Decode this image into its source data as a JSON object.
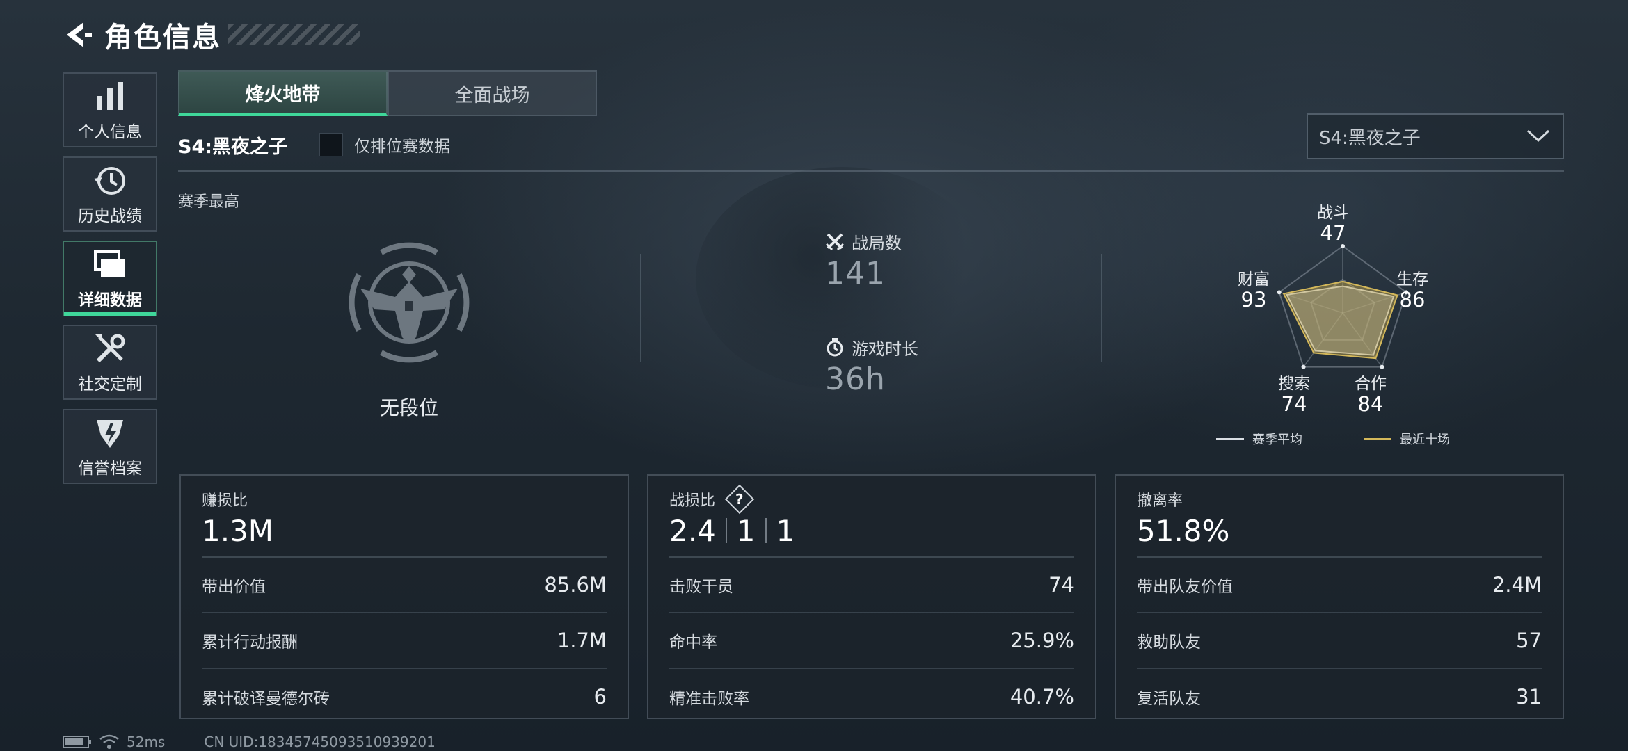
{
  "header": {
    "title": "角色信息"
  },
  "sidebar": {
    "items": [
      {
        "label": "个人信息",
        "icon": "bar-chart-icon",
        "active": false
      },
      {
        "label": "历史战绩",
        "icon": "history-clock-icon",
        "active": false
      },
      {
        "label": "详细数据",
        "icon": "folder-stack-icon",
        "active": true
      },
      {
        "label": "社交定制",
        "icon": "tools-icon",
        "active": false
      },
      {
        "label": "信誉档案",
        "icon": "shield-badge-icon",
        "active": false
      }
    ]
  },
  "tabs": [
    {
      "label": "烽火地带",
      "active": true
    },
    {
      "label": "全面战场",
      "active": false
    }
  ],
  "season": {
    "name": "S4:黑夜之子",
    "ranked_only_label": "仅排位赛数据",
    "ranked_only_checked": false,
    "selector_value": "S4:黑夜之子"
  },
  "season_best": {
    "label": "赛季最高",
    "rank_text": "无段位"
  },
  "mid_stats": {
    "matches_label": "战局数",
    "matches_value": "141",
    "playtime_label": "游戏时长",
    "playtime_value": "36h"
  },
  "radar": {
    "axes": [
      {
        "label": "战斗",
        "value": "47"
      },
      {
        "label": "生存",
        "value": "86"
      },
      {
        "label": "合作",
        "value": "84"
      },
      {
        "label": "搜索",
        "value": "74"
      },
      {
        "label": "财富",
        "value": "93"
      }
    ],
    "season_avg": [
      40,
      80,
      78,
      70,
      88
    ],
    "recent_ten": [
      47,
      86,
      84,
      74,
      93
    ],
    "legend_avg": "赛季平均",
    "legend_recent": "最近十场",
    "color_avg": "#d9dee3",
    "color_recent": "#d4b85a"
  },
  "cards": {
    "profit": {
      "title": "赚损比",
      "main": "1.3M",
      "rows": [
        {
          "k": "带出价值",
          "v": "85.6M"
        },
        {
          "k": "累计行动报酬",
          "v": "1.7M"
        },
        {
          "k": "累计破译曼德尔砖",
          "v": "6"
        }
      ]
    },
    "combat": {
      "title": "战损比",
      "help": "?",
      "main": [
        "2.4",
        "1",
        "1"
      ],
      "rows": [
        {
          "k": "击败干员",
          "v": "74"
        },
        {
          "k": "命中率",
          "v": "25.9%"
        },
        {
          "k": "精准击败率",
          "v": "40.7%"
        }
      ]
    },
    "extract": {
      "title": "撤离率",
      "main": "51.8%",
      "rows": [
        {
          "k": "带出队友价值",
          "v": "2.4M"
        },
        {
          "k": "救助队友",
          "v": "57"
        },
        {
          "k": "复活队友",
          "v": "31"
        }
      ]
    }
  },
  "footer": {
    "ping": "52ms",
    "uid": "CN UID:18345745093510939201"
  },
  "colors": {
    "accent": "#3fd79a",
    "background": "#1c252e"
  }
}
